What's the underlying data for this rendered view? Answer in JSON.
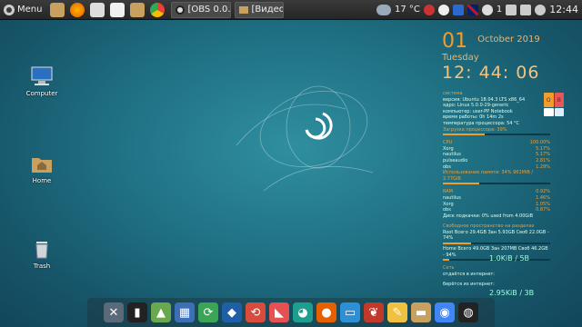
{
  "top_panel": {
    "menu_label": "Menu",
    "launchers": [
      {
        "name": "file-manager-icon",
        "color": "#c8a060"
      },
      {
        "name": "firefox-icon",
        "color": "#e66000"
      },
      {
        "name": "screenshot-icon",
        "color": "#dddddd"
      },
      {
        "name": "text-editor-icon",
        "color": "#f0f0f0"
      },
      {
        "name": "folder-icon",
        "color": "#c8a060"
      },
      {
        "name": "chrome-icon",
        "color": "#4285f4"
      }
    ],
    "tasks": [
      {
        "label": "[OBS 0.0...",
        "icon": "obs-icon"
      },
      {
        "label": "[Видео]",
        "icon": "folder-icon"
      }
    ],
    "weather_temp": "17 °C",
    "keyboard_layout_icon": "uk-flag-icon",
    "notification_count": "1",
    "time": "12:44"
  },
  "desktop_icons": [
    {
      "label": "Computer",
      "icon": "computer-icon"
    },
    {
      "label": "Home",
      "icon": "home-folder-icon"
    },
    {
      "label": "Trash",
      "icon": "trash-icon"
    }
  ],
  "clock": {
    "day": "01",
    "month": "October 2019",
    "weekday": "Tuesday",
    "time": "12: 44: 06"
  },
  "conky": {
    "system_header": "система",
    "system_lines": [
      "версия: Ubuntu 18.04.3 LTS x86_64",
      "ядро: Linux 5.0.0-29-generic",
      "компьютер: user-PP Notebook",
      "время работы: 0h 14m 2s",
      "температура процессора: 54 °C"
    ],
    "cpu_label": "Загрузка процессора: 39%",
    "cpu_fraction": 0.39,
    "cpu_header": "CPU",
    "cpu_value": "100.00%",
    "cpu_processes": [
      {
        "name": "Xorg",
        "value": "5.17%"
      },
      {
        "name": "nautilus",
        "value": "5.17%"
      },
      {
        "name": "pulseaudio",
        "value": "2.81%"
      },
      {
        "name": "obs",
        "value": "1.29%"
      }
    ],
    "ram_label": "Использование памяти: 34% 961MiB / 2.77GiB",
    "ram_fraction": 0.34,
    "ram_header": "RAM",
    "ram_value": "0.92%",
    "ram_processes": [
      {
        "name": "nautilus",
        "value": "1.46%"
      },
      {
        "name": "Xorg",
        "value": "1.05%"
      },
      {
        "name": "obs",
        "value": "0.87%"
      }
    ],
    "swap_label": "Диск подкачки: 0% used from 4.00GiB",
    "disk_header": "Свободное пространство на разделах",
    "disk_root": "Root Всего 29.4GB Зан 5.93GB Своб 22.0GB - 74%",
    "disk_root_fraction": 0.26,
    "disk_home": "Home Всего 49.0GB Зан 207MB Своб 46.2GB - 94%",
    "disk_home_fraction": 0.06,
    "net_header": "Сеть",
    "net_status": "отдаётся в интернет:",
    "net_upload": "1.0KiB / 5B",
    "net_download_label": "берётся из интернет:",
    "net_download": "2.95KiB / 3B"
  },
  "os_tiles": [
    {
      "label": "O",
      "color": "#f39c2e"
    },
    {
      "label": "B",
      "color": "#e65757"
    },
    {
      "label": "",
      "color": "#ffffff"
    },
    {
      "label": "",
      "color": "#ddeeff"
    }
  ],
  "dock": [
    {
      "name": "settings-tools-icon",
      "glyph": "✕",
      "bg": "#5a6a7a"
    },
    {
      "name": "terminal-icon",
      "glyph": "▮",
      "bg": "#222222"
    },
    {
      "name": "image-viewer-icon",
      "glyph": "▲",
      "bg": "#6aa84f"
    },
    {
      "name": "calculator-icon",
      "glyph": "▦",
      "bg": "#3d6fb6"
    },
    {
      "name": "sync-icon",
      "glyph": "⟳",
      "bg": "#3aa655"
    },
    {
      "name": "virtualbox-icon",
      "glyph": "◆",
      "bg": "#1f5fa8"
    },
    {
      "name": "system-update-icon",
      "glyph": "⟲",
      "bg": "#d94c3d"
    },
    {
      "name": "software-center-icon",
      "glyph": "◣",
      "bg": "#e65050"
    },
    {
      "name": "disk-usage-icon",
      "glyph": "◕",
      "bg": "#1e9e8e"
    },
    {
      "name": "firefox-icon",
      "glyph": "●",
      "bg": "#e66000"
    },
    {
      "name": "tv-icon",
      "glyph": "▭",
      "bg": "#2d8fd5"
    },
    {
      "name": "cherry-icon",
      "glyph": "❦",
      "bg": "#c0392b"
    },
    {
      "name": "notes-icon",
      "glyph": "✎",
      "bg": "#f0c040"
    },
    {
      "name": "folder-icon",
      "glyph": "▬",
      "bg": "#c8a060"
    },
    {
      "name": "chrome-icon",
      "glyph": "◉",
      "bg": "#4285f4"
    },
    {
      "name": "obs-icon",
      "glyph": "◍",
      "bg": "#222222"
    }
  ]
}
